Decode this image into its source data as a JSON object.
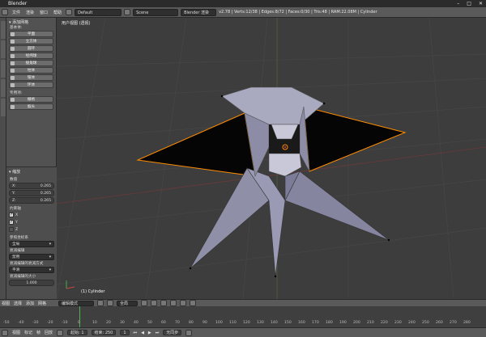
{
  "window": {
    "title": "Blender"
  },
  "topbar": {
    "menus": [
      "文件",
      "渲染",
      "窗口",
      "帮助"
    ],
    "layout": "Default",
    "scene": "Scene",
    "engine": "Blender 渲染",
    "stats": "v2.78 | Verts:12/38 | Edges:8/72 | Faces:0/30 | Tris:48 | RAM:22.08M | Cylinder"
  },
  "tool_panel": {
    "add_section": "添加网格",
    "basic_label": "基本体:",
    "basic_buttons": [
      "平面",
      "立方体",
      "圆环",
      "经纬球",
      "棱角球",
      "柱体",
      "锥体",
      "环体"
    ],
    "special_label": "专用项:",
    "special_buttons": [
      "栅格",
      "猴头"
    ],
    "op_section": "缩放",
    "value_label": "数值",
    "values": [
      {
        "axis": "X:",
        "value": "0.265"
      },
      {
        "axis": "Y:",
        "value": "0.265"
      },
      {
        "axis": "Z:",
        "value": "0.265"
      }
    ],
    "constraint_label": "约束轴",
    "axes": [
      "X",
      "Y",
      "Z"
    ],
    "orientation_label": "参照坐标系",
    "orientation_value": "全局",
    "proportional_label": "衰减编辑",
    "proportional_value": "禁用",
    "falloff_label": "衰减编辑的衰减方式",
    "falloff_value": "平滑",
    "size_label": "衰减编辑的大小",
    "size_value": "1.000"
  },
  "viewport": {
    "view_label": "用户视图 (透视)",
    "object_label": "(1) Cylinder"
  },
  "header3d": {
    "menus": [
      "视图",
      "选择",
      "添加",
      "网格"
    ],
    "mode": "编辑模式",
    "pivot": "全局"
  },
  "timeline": {
    "ticks": [
      "-50",
      "-40",
      "-30",
      "-20",
      "-10",
      "0",
      "10",
      "20",
      "30",
      "40",
      "50",
      "60",
      "70",
      "80",
      "90",
      "100",
      "110",
      "120",
      "130",
      "140",
      "150",
      "160",
      "170",
      "180",
      "190",
      "200",
      "210",
      "220",
      "230",
      "240",
      "250",
      "260",
      "270",
      "280"
    ]
  },
  "bottombar": {
    "menus": [
      "视图",
      "标记",
      "帧",
      "回放"
    ],
    "start_label": "起始:",
    "start_value": "1",
    "end_label": "结束:",
    "end_value": "250",
    "current": "1",
    "sync": "无同步"
  },
  "colors": {
    "mesh_face": "#8f8fa8",
    "selection": "#ff8c00",
    "dark_face": "#050505"
  }
}
